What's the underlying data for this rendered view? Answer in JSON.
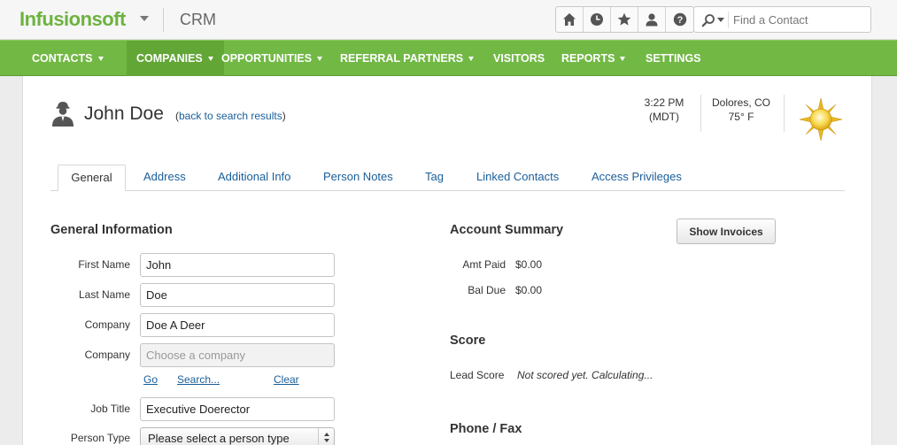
{
  "app": {
    "logo": "Infusionsoft",
    "product": "CRM",
    "search": {
      "placeholder": "Find a Contact"
    },
    "icons": [
      "home-icon",
      "clock-icon",
      "star-icon",
      "user-icon",
      "help-icon"
    ]
  },
  "nav": {
    "items": [
      {
        "label": "CONTACTS",
        "caret": true
      },
      {
        "label": "COMPANIES",
        "caret": true,
        "active": true
      },
      {
        "label": "OPPORTUNITIES",
        "caret": true
      },
      {
        "label": "REFERRAL PARTNERS",
        "caret": true
      },
      {
        "label": "VISITORS",
        "caret": false
      },
      {
        "label": "REPORTS",
        "caret": true
      },
      {
        "label": "SETTINGS",
        "caret": false
      }
    ]
  },
  "header": {
    "name": "John Doe",
    "back_prefix": "(",
    "back_link": "back to search results",
    "back_suffix": ")",
    "time": "3:22 PM",
    "timezone": "(MDT)",
    "location": "Dolores, CO",
    "temperature": "75° F"
  },
  "tabs": [
    {
      "label": "General",
      "active": true
    },
    {
      "label": "Address"
    },
    {
      "label": "Additional Info"
    },
    {
      "label": "Person Notes"
    },
    {
      "label": "Tag"
    },
    {
      "label": "Linked Contacts"
    },
    {
      "label": "Access Privileges"
    }
  ],
  "general": {
    "title": "General Information",
    "first_name_label": "First Name",
    "first_name": "John",
    "last_name_label": "Last Name",
    "last_name": "Doe",
    "company_label": "Company",
    "company": "Doe A Deer",
    "company2_label": "Company",
    "company2_placeholder": "Choose a company",
    "go": "Go",
    "search": "Search...",
    "clear": "Clear",
    "job_title_label": "Job Title",
    "job_title": "Executive Doerector",
    "person_type_label": "Person Type",
    "person_type": "Please select a person type"
  },
  "account": {
    "title": "Account Summary",
    "show_invoices": "Show Invoices",
    "amt_paid_label": "Amt Paid",
    "amt_paid": "$0.00",
    "bal_due_label": "Bal Due",
    "bal_due": "$0.00"
  },
  "score": {
    "title": "Score",
    "lead_score_label": "Lead Score",
    "lead_score": "Not scored yet. Calculating..."
  },
  "phone": {
    "title": "Phone / Fax"
  }
}
